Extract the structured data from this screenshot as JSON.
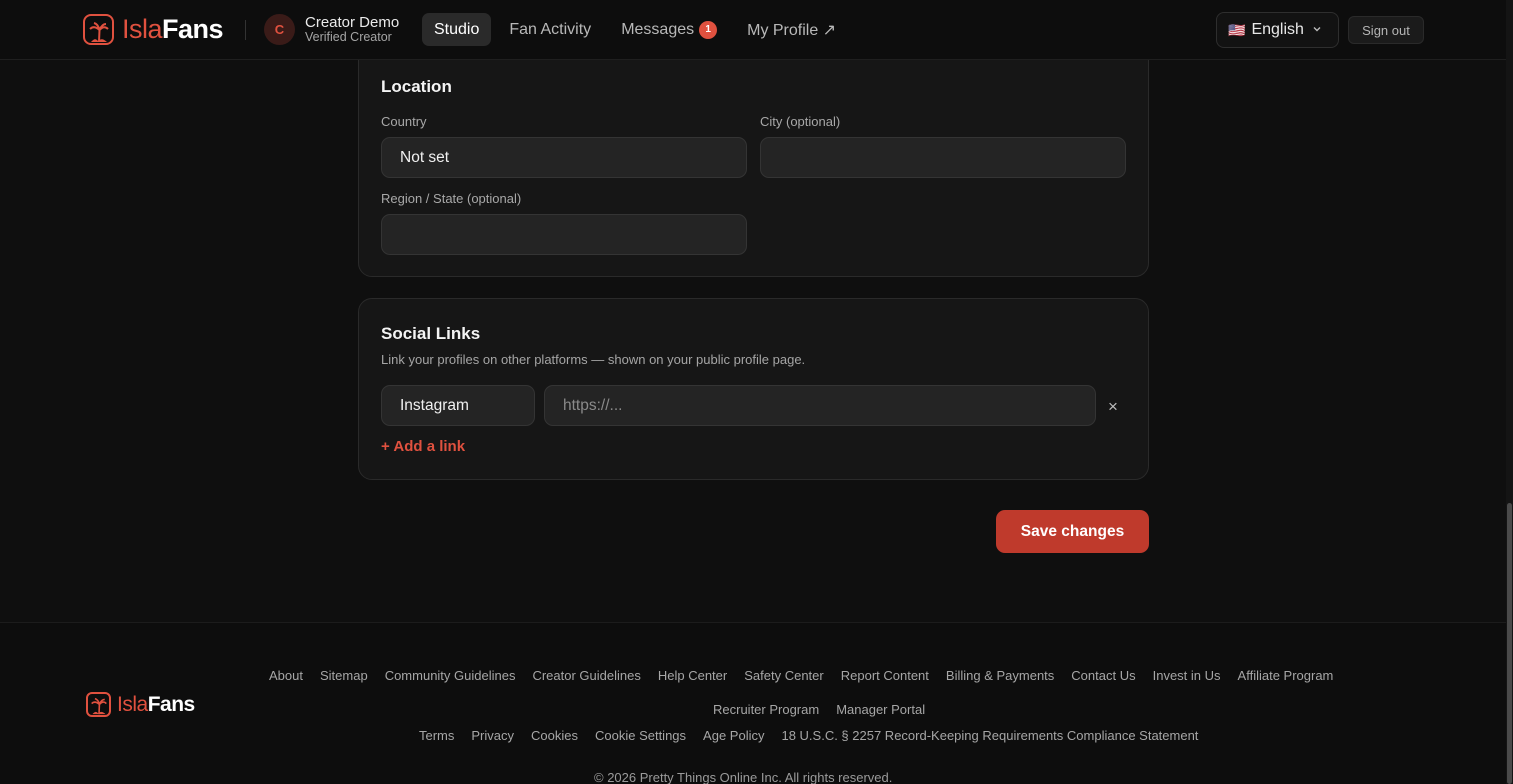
{
  "header": {
    "brand": {
      "isla": "Isla",
      "fans": "Fans"
    },
    "creator": {
      "initial": "C",
      "name": "Creator Demo",
      "role": "Verified Creator"
    },
    "nav": [
      {
        "label": "Studio",
        "active": true
      },
      {
        "label": "Fan Activity",
        "active": false
      },
      {
        "label": "Messages",
        "badge": "1",
        "active": false
      },
      {
        "label": "My Profile ↗",
        "active": false
      }
    ],
    "language": {
      "flag": "🇺🇸",
      "label": "English"
    },
    "sign_out": "Sign out"
  },
  "location": {
    "title": "Location",
    "country_label": "Country",
    "country_value": "Not set",
    "city_label": "City (optional)",
    "city_value": "",
    "region_label": "Region / State (optional)",
    "region_value": ""
  },
  "social": {
    "title": "Social Links",
    "description": "Link your profiles on other platforms — shown on your public profile page.",
    "links": [
      {
        "platform": "Instagram",
        "url_placeholder": "https://..."
      }
    ],
    "remove_symbol": "×",
    "add_link": "+ Add a link"
  },
  "save_button": "Save changes",
  "footer": {
    "brand": {
      "isla": "Isla",
      "fans": "Fans"
    },
    "row1": [
      "About",
      "Sitemap",
      "Community Guidelines",
      "Creator Guidelines",
      "Help Center",
      "Safety Center",
      "Report Content",
      "Billing & Payments",
      "Contact Us",
      "Invest in Us",
      "Affiliate Program"
    ],
    "row2": [
      "Recruiter Program",
      "Manager Portal"
    ],
    "row3": [
      "Terms",
      "Privacy",
      "Cookies",
      "Cookie Settings",
      "Age Policy",
      "18 U.S.C. § 2257 Record-Keeping Requirements Compliance Statement"
    ],
    "copyright": "© 2026 Pretty Things Online Inc. All rights reserved."
  },
  "colors": {
    "accent": "#e0513f",
    "save": "#bf3a2c",
    "background": "#0f0f0f",
    "card": "#161616"
  }
}
